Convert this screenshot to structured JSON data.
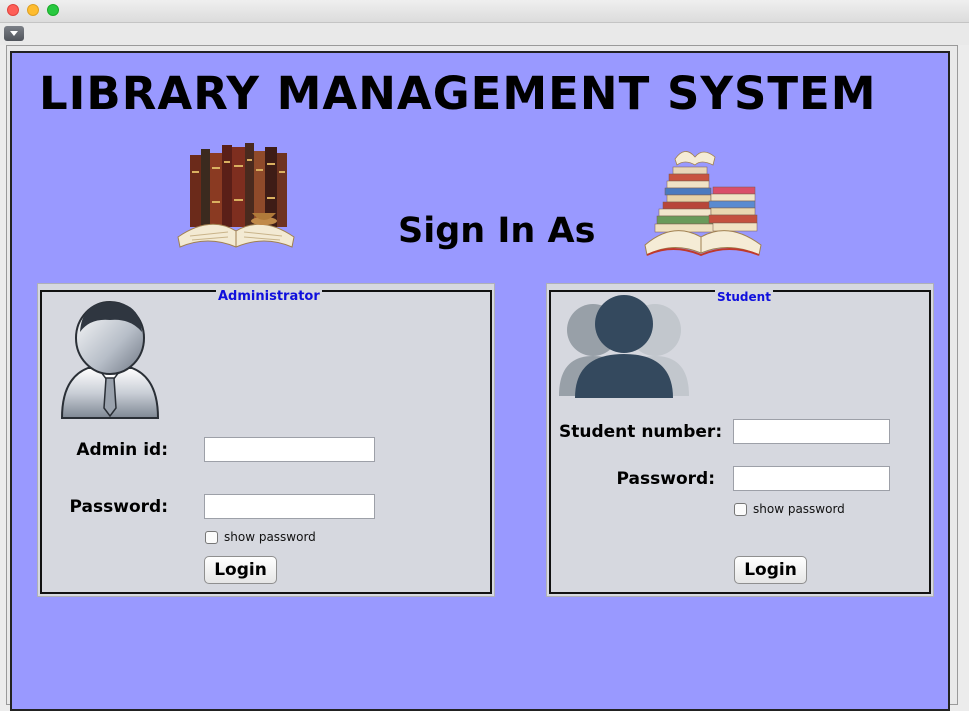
{
  "window": {
    "controls": [
      "close",
      "minimize",
      "maximize"
    ]
  },
  "app": {
    "title": "LIBRARY MANAGEMENT SYSTEM",
    "sign_in_label": "Sign In As",
    "background_color": "#9999ff"
  },
  "admin_panel": {
    "legend": "Administrator",
    "id_label": "Admin id:",
    "id_value": "",
    "password_label": "Password:",
    "password_value": "",
    "show_password_label": "show password",
    "show_password_checked": false,
    "login_label": "Login"
  },
  "student_panel": {
    "legend": "Student",
    "number_label": "Student number:",
    "number_value": "",
    "password_label": "Password:",
    "password_value": "",
    "show_password_label": "show password",
    "show_password_checked": false,
    "login_label": "Login"
  },
  "colors": {
    "legend_text": "#1010dd",
    "panel_bg": "#d6d8df"
  }
}
